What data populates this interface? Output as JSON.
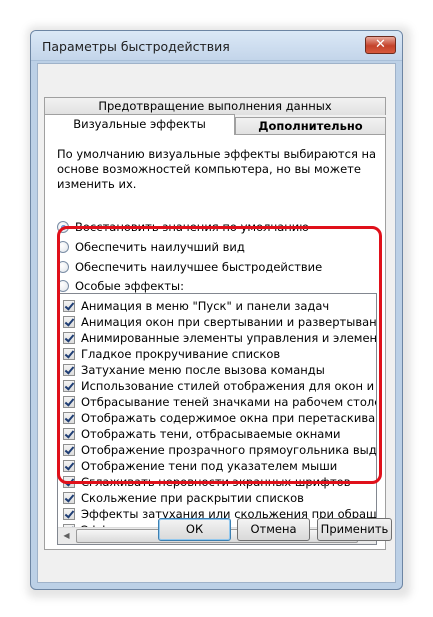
{
  "window": {
    "title": "Параметры быстродействия",
    "close_symbol": "✕"
  },
  "tabs": {
    "prevention": "Предотвращение выполнения данных",
    "visual": "Визуальные эффекты",
    "advanced": "Дополнительно"
  },
  "description": "По умолчанию визуальные эффекты выбираются на основе возможностей компьютера, но вы можете изменить их.",
  "radios": [
    {
      "label": "Восстановить значения по умолчанию",
      "selected": true
    },
    {
      "label": "Обеспечить наилучший вид",
      "selected": false
    },
    {
      "label": "Обеспечить наилучшее быстродействие",
      "selected": false
    },
    {
      "label": "Особые эффекты:",
      "selected": false
    }
  ],
  "effects": [
    "Анимация в меню \"Пуск\" и панели задач",
    "Анимация окон при свертывании и развертывании",
    "Анимированные элементы управления и элементы внутри",
    "Гладкое прокручивание списков",
    "Затухание меню после вызова команды",
    "Использование стилей отображения для окон и кнопок",
    "Отбрасывание теней значками на рабочем столе",
    "Отображать содержимое окна при перетаскивании",
    "Отображать тени, отбрасываемые окнами",
    "Отображение прозрачного прямоугольника выделения",
    "Отображение тени под указателем мыши",
    "Сглаживать неровности экранных шрифтов",
    "Скольжение при раскрытии списков",
    "Эффекты затухания или скольжения при обращении к ме",
    "Эффекты затухания или скольжения при появлении подс"
  ],
  "scrollbar": {
    "left_arrow": "◀",
    "right_arrow": "▶",
    "grip": "|||"
  },
  "buttons": {
    "ok": "ОК",
    "cancel": "Отмена",
    "apply": "Применить"
  },
  "colors": {
    "highlight": "#e0101a",
    "accent": "#3c7fb1"
  }
}
